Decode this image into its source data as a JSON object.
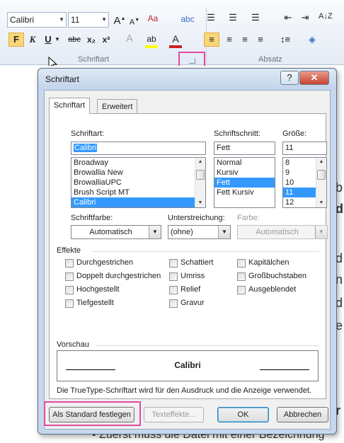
{
  "ribbon": {
    "font_name": "Calibri",
    "font_size": "11",
    "grow_font": "A",
    "shrink_font": "A",
    "bold": "F",
    "italic": "K",
    "underline": "U",
    "strike": "abc",
    "subscript": "x₂",
    "superscript": "x²",
    "group_font_label": "Schriftart",
    "group_paragraph_label": "Absatz"
  },
  "dialog": {
    "title": "Schriftart",
    "help": "?",
    "close": "✕",
    "tabs": [
      "Schriftart",
      "Erweitert"
    ],
    "font_label": "Schriftart:",
    "font_value": "Calibri",
    "font_list": [
      "Broadway",
      "Browallia New",
      "BrowalliaUPC",
      "Brush Script MT",
      "Calibri"
    ],
    "font_list_selected": 4,
    "style_label": "Schriftschnitt:",
    "style_value": "Fett",
    "style_list": [
      "Normal",
      "Kursiv",
      "Fett",
      "Fett Kursiv"
    ],
    "style_list_selected": 2,
    "size_label": "Größe:",
    "size_value": "11",
    "size_list": [
      "8",
      "9",
      "10",
      "11",
      "12"
    ],
    "size_list_selected": 3,
    "font_color_label": "Schriftfarbe:",
    "font_color_value": "Automatisch",
    "underline_label": "Unterstreichung:",
    "underline_value": "(ohne)",
    "color_label": "Farbe:",
    "color_value": "Automatisch",
    "effects_label": "Effekte",
    "effects": {
      "col1": [
        "Durchgestrichen",
        "Doppelt durchgestrichen",
        "Hochgestellt",
        "Tiefgestellt"
      ],
      "col2": [
        "Schattiert",
        "Umriss",
        "Relief",
        "Gravur"
      ],
      "col3": [
        "Kapitälchen",
        "Großbuchstaben",
        "Ausgeblendet"
      ]
    },
    "preview_label": "Vorschau",
    "preview_text": "Calibri",
    "preview_note": "Die TrueType-Schriftart wird für den Ausdruck und die Anzeige verwendet.",
    "btn_default": "Als Standard festlegen",
    "btn_effects": "Texteffekte...",
    "btn_ok": "OK",
    "btn_cancel": "Abbrechen"
  },
  "document": {
    "bottom_text": "Zuerst muss die Datei mit einer Bezeichnung"
  },
  "colors": {
    "highlight_box": "#e14ba0",
    "selection": "#3399ff",
    "dialog_frame": "#c7d8ec",
    "close_button": "#c8432f"
  }
}
